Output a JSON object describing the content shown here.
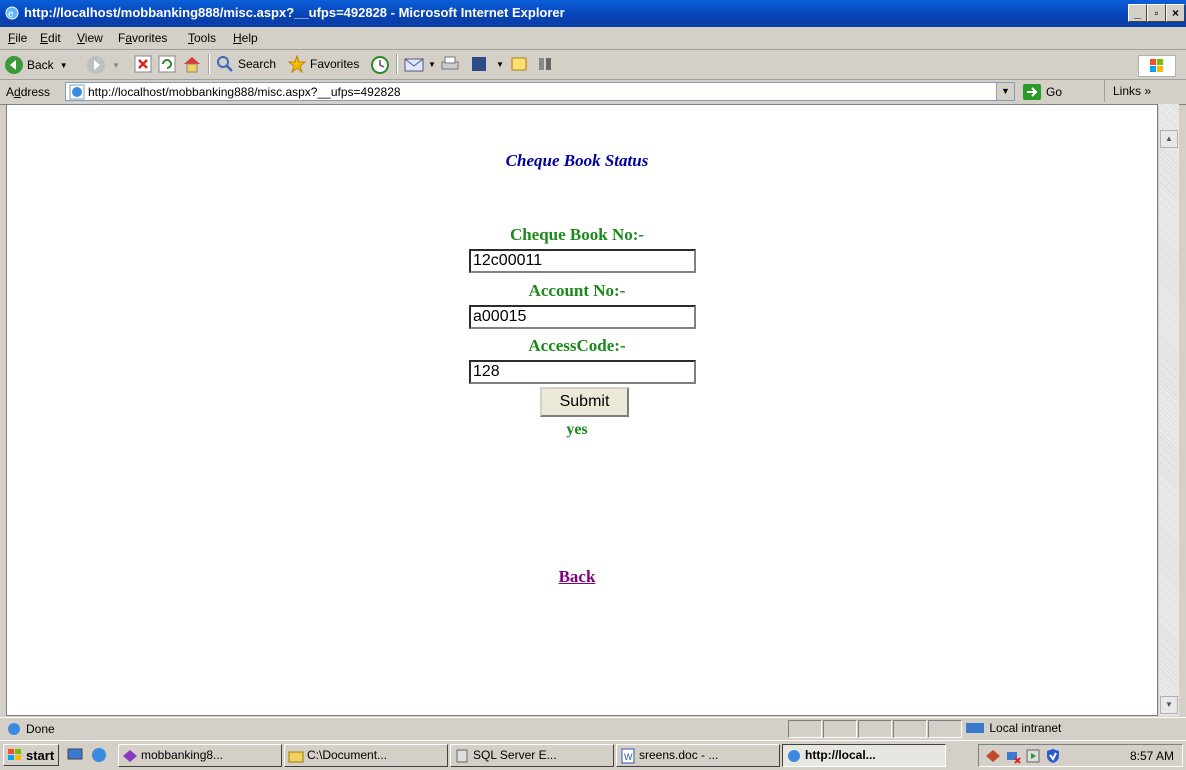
{
  "window": {
    "title": "http://localhost/mobbanking888/misc.aspx?__ufps=492828 - Microsoft Internet Explorer",
    "minimize": "_",
    "maximize": "▫",
    "close": "×"
  },
  "menu": [
    {
      "label": "File",
      "u": "F",
      "rest": "ile"
    },
    {
      "label": "Edit",
      "u": "E",
      "rest": "dit"
    },
    {
      "label": "View",
      "u": "V",
      "rest": "iew"
    },
    {
      "label": "Favorites",
      "pre": "F",
      "u": "a",
      "rest": "vorites"
    },
    {
      "label": "Tools",
      "u": "T",
      "rest": "ools"
    },
    {
      "label": "Help",
      "u": "H",
      "rest": "elp"
    }
  ],
  "toolbar": {
    "back": "Back",
    "search": "Search",
    "favorites": "Favorites"
  },
  "address": {
    "label_pre": "A",
    "label_u": "d",
    "label_rest": "dress",
    "url": "http://localhost/mobbanking888/misc.aspx?__ufps=492828",
    "go": "Go",
    "links": "Links »"
  },
  "page": {
    "title": "Cheque Book Status",
    "cheque_label": "Cheque Book No:-",
    "cheque_value": "12c00011",
    "account_label": "Account No:-",
    "account_value": "a00015",
    "access_label": "AccessCode:-",
    "access_value": "128",
    "submit": "Submit",
    "result": "yes",
    "back": "Back"
  },
  "status": {
    "text": "Done",
    "zone": "Local intranet"
  },
  "taskbar": {
    "start": "start",
    "tasks": [
      "mobbanking8...",
      "C:\\Document...",
      "SQL Server E...",
      "sreens.doc - ...",
      "http://local..."
    ],
    "clock": "8:57 AM"
  }
}
